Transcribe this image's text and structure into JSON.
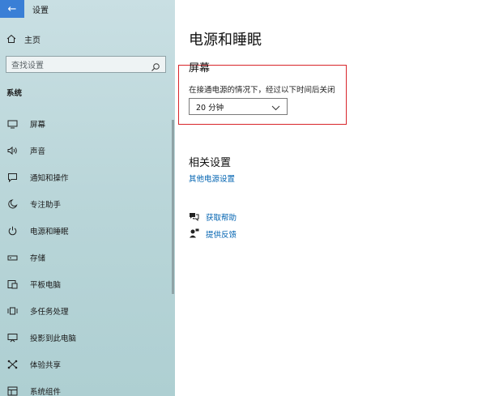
{
  "app": {
    "title": "设置",
    "back_glyph": "←"
  },
  "sidebar": {
    "home_label": "主页",
    "search_placeholder": "查找设置",
    "section_label": "系统",
    "items": [
      {
        "label": "屏幕",
        "icon": "monitor-icon"
      },
      {
        "label": "声音",
        "icon": "speaker-icon"
      },
      {
        "label": "通知和操作",
        "icon": "notification-icon"
      },
      {
        "label": "专注助手",
        "icon": "moon-icon"
      },
      {
        "label": "电源和睡眠",
        "icon": "power-icon"
      },
      {
        "label": "存储",
        "icon": "storage-icon"
      },
      {
        "label": "平板电脑",
        "icon": "tablet-icon"
      },
      {
        "label": "多任务处理",
        "icon": "multitask-icon"
      },
      {
        "label": "投影到此电脑",
        "icon": "project-icon"
      },
      {
        "label": "体验共享",
        "icon": "share-icon"
      },
      {
        "label": "系统组件",
        "icon": "components-icon"
      }
    ]
  },
  "main": {
    "title": "电源和睡眠",
    "screen": {
      "heading": "屏幕",
      "description": "在接通电源的情况下，经过以下时间后关闭",
      "selected": "20 分钟"
    },
    "related": {
      "heading": "相关设置",
      "link": "其他电源设置"
    },
    "help": {
      "get_help": "获取帮助",
      "feedback": "提供反馈"
    }
  },
  "colors": {
    "accent": "#3a7fd6",
    "link": "#0063b1",
    "highlight": "#d8252a"
  }
}
